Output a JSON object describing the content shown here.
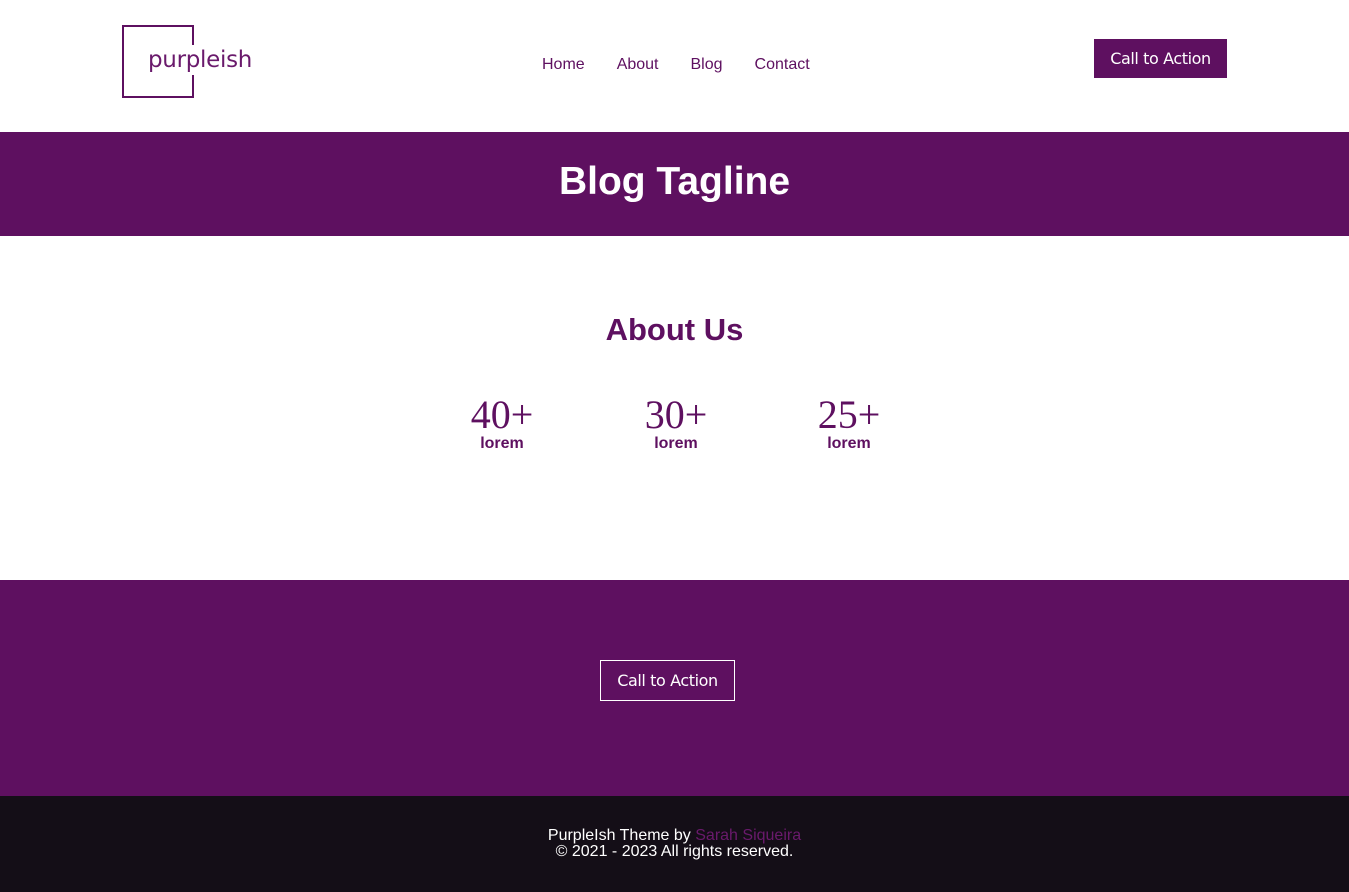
{
  "brand": {
    "logo_text": "purpleish",
    "primary_color": "#5e1060",
    "dark_color": "#140e17"
  },
  "nav": {
    "items": [
      "Home",
      "About",
      "Blog",
      "Contact"
    ]
  },
  "header": {
    "cta_label": "Call to Action"
  },
  "banner": {
    "title": "Blog Tagline"
  },
  "about": {
    "title": "About Us",
    "stats": [
      {
        "value": "40+",
        "label": "lorem"
      },
      {
        "value": "30+",
        "label": "lorem"
      },
      {
        "value": "25+",
        "label": "lorem"
      }
    ]
  },
  "cta_section": {
    "button_label": "Call to Action"
  },
  "footer": {
    "theme_text": "PurpleIsh Theme by",
    "author_link": "Sarah Siqueira",
    "copyright": "© 2021 - 2023 All rights reserved."
  }
}
